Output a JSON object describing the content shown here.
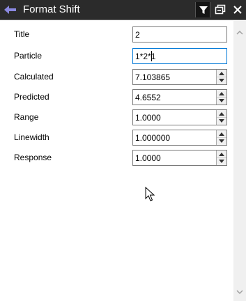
{
  "window": {
    "title": "Format Shift",
    "accent": "#8a88e0",
    "titlebar_bg": "#2b2b2b",
    "icons": [
      "back-arrow-icon",
      "filter-icon",
      "restore-window-icon",
      "close-icon"
    ]
  },
  "form": {
    "fields": [
      {
        "label": "Title",
        "value": "2",
        "spinner": false
      },
      {
        "label": "Particle",
        "value": "1*2*1",
        "spinner": false,
        "focused": true
      },
      {
        "label": "Calculated",
        "value": "7.103865",
        "spinner": true
      },
      {
        "label": "Predicted",
        "value": "4.6552",
        "spinner": true
      },
      {
        "label": "Range",
        "value": "1.0000",
        "spinner": true
      },
      {
        "label": "Linewidth",
        "value": "1.000000",
        "spinner": true
      },
      {
        "label": "Response",
        "value": "1.0000",
        "spinner": true
      }
    ]
  }
}
